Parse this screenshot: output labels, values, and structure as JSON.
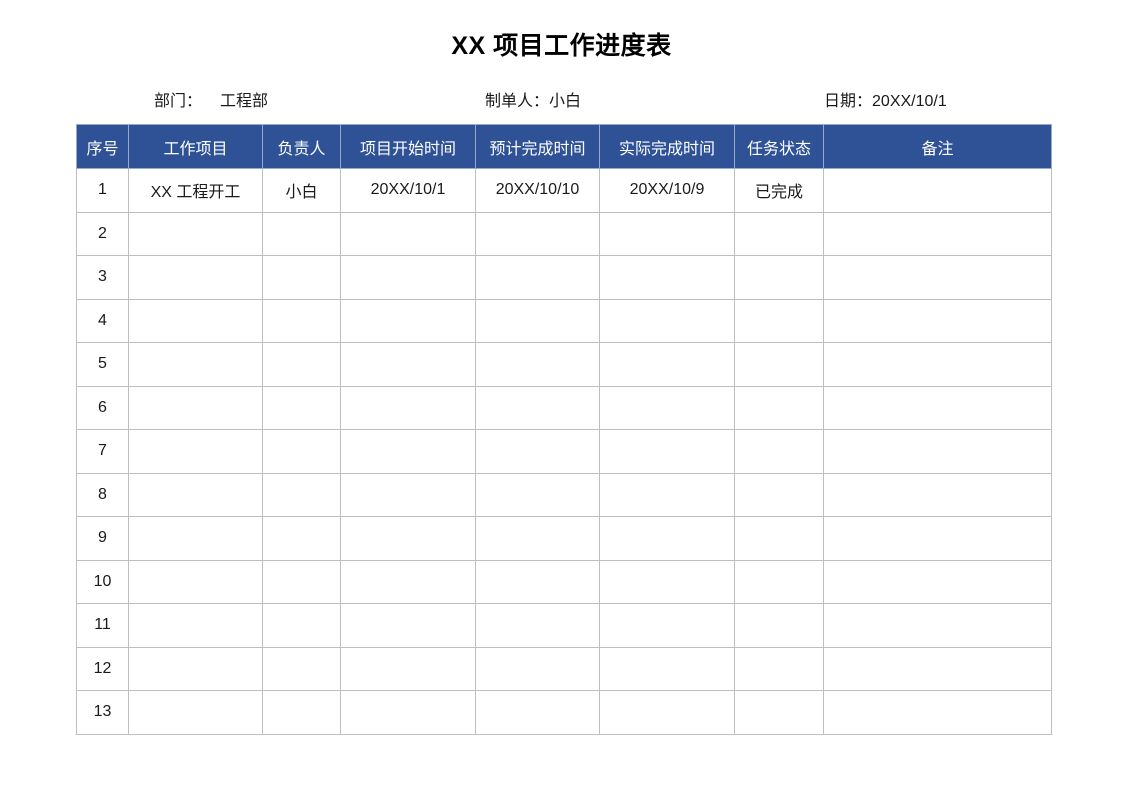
{
  "document": {
    "title": "XX 项目工作进度表"
  },
  "meta": {
    "department": {
      "label": "部门：",
      "value": "工程部"
    },
    "preparer": {
      "label": "制单人：",
      "value": "小白"
    },
    "date": {
      "label": "日期：",
      "value": "20XX/10/1"
    }
  },
  "table": {
    "headers": [
      "序号",
      "工作项目",
      "负责人",
      "项目开始时间",
      "预计完成时间",
      "实际完成时间",
      "任务状态",
      "备注"
    ],
    "rows": [
      {
        "index": "1",
        "task": "XX 工程开工",
        "owner": "小白",
        "start": "20XX/10/1",
        "planned": "20XX/10/10",
        "actual": "20XX/10/9",
        "status": "已完成",
        "remark": ""
      },
      {
        "index": "2",
        "task": "",
        "owner": "",
        "start": "",
        "planned": "",
        "actual": "",
        "status": "",
        "remark": ""
      },
      {
        "index": "3",
        "task": "",
        "owner": "",
        "start": "",
        "planned": "",
        "actual": "",
        "status": "",
        "remark": ""
      },
      {
        "index": "4",
        "task": "",
        "owner": "",
        "start": "",
        "planned": "",
        "actual": "",
        "status": "",
        "remark": ""
      },
      {
        "index": "5",
        "task": "",
        "owner": "",
        "start": "",
        "planned": "",
        "actual": "",
        "status": "",
        "remark": ""
      },
      {
        "index": "6",
        "task": "",
        "owner": "",
        "start": "",
        "planned": "",
        "actual": "",
        "status": "",
        "remark": ""
      },
      {
        "index": "7",
        "task": "",
        "owner": "",
        "start": "",
        "planned": "",
        "actual": "",
        "status": "",
        "remark": ""
      },
      {
        "index": "8",
        "task": "",
        "owner": "",
        "start": "",
        "planned": "",
        "actual": "",
        "status": "",
        "remark": ""
      },
      {
        "index": "9",
        "task": "",
        "owner": "",
        "start": "",
        "planned": "",
        "actual": "",
        "status": "",
        "remark": ""
      },
      {
        "index": "10",
        "task": "",
        "owner": "",
        "start": "",
        "planned": "",
        "actual": "",
        "status": "",
        "remark": ""
      },
      {
        "index": "11",
        "task": "",
        "owner": "",
        "start": "",
        "planned": "",
        "actual": "",
        "status": "",
        "remark": ""
      },
      {
        "index": "12",
        "task": "",
        "owner": "",
        "start": "",
        "planned": "",
        "actual": "",
        "status": "",
        "remark": ""
      },
      {
        "index": "13",
        "task": "",
        "owner": "",
        "start": "",
        "planned": "",
        "actual": "",
        "status": "",
        "remark": ""
      }
    ]
  },
  "colors": {
    "header_background": "#2e5295",
    "header_text": "#ffffff",
    "grid_line": "#bfbfbf",
    "page_background": "#ffffff"
  }
}
